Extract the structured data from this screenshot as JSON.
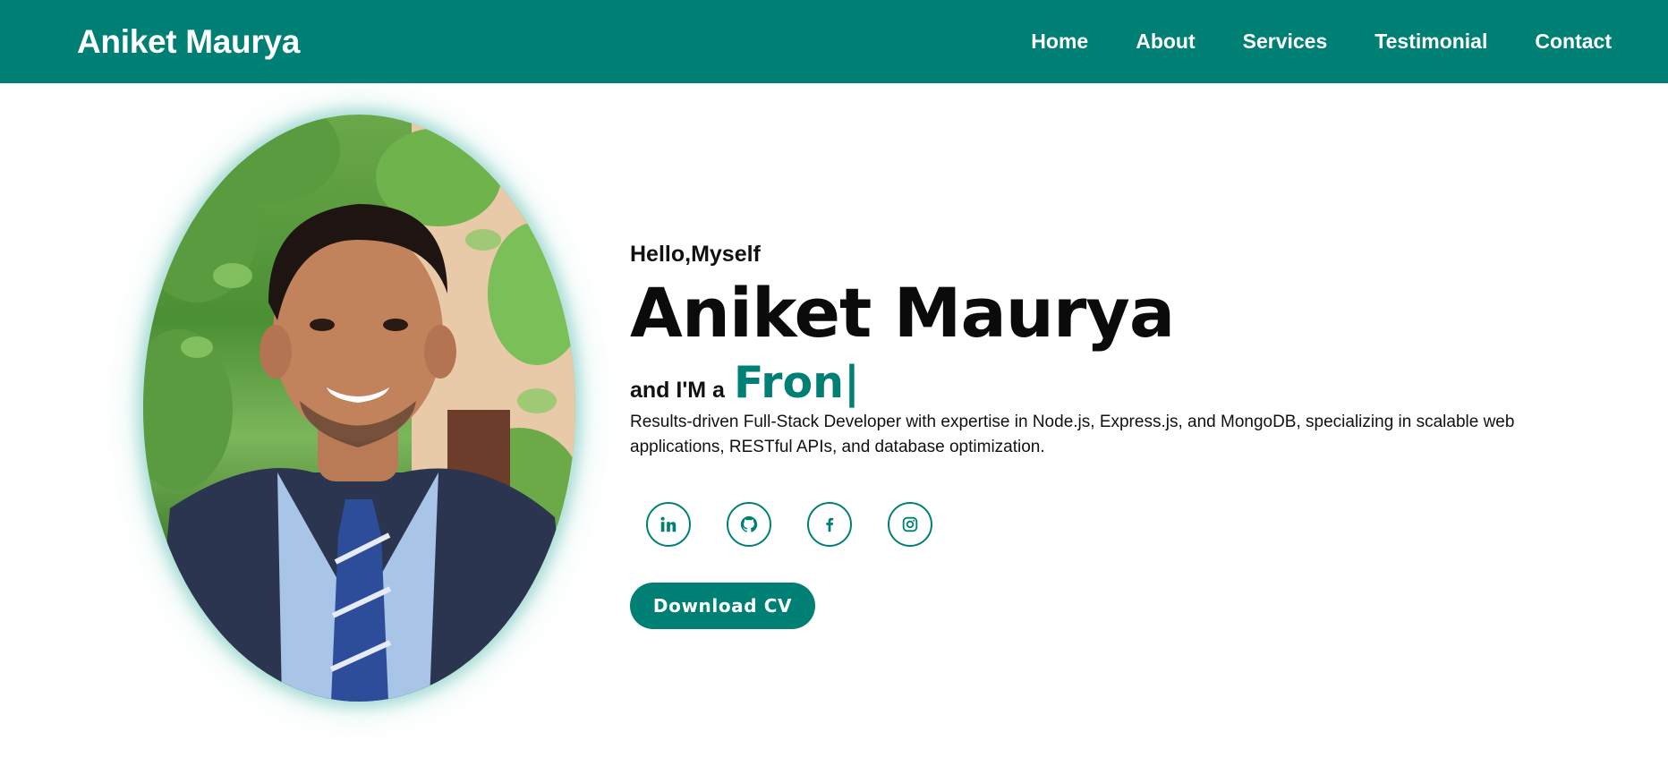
{
  "header": {
    "brand": "Aniket Maurya",
    "nav": [
      "Home",
      "About",
      "Services",
      "Testimonial",
      "Contact"
    ]
  },
  "hero": {
    "greeting": "Hello,Myself",
    "name": "Aniket Maurya",
    "role_prefix": "and I'M a",
    "role_typed": "Fron|",
    "description": "Results-driven Full-Stack Developer with expertise in Node.js, Express.js, and MongoDB, specializing in scalable web applications, RESTful APIs, and database optimization.",
    "cv_button": "Download CV"
  },
  "socials": [
    {
      "name": "linkedin-icon"
    },
    {
      "name": "github-icon"
    },
    {
      "name": "facebook-icon"
    },
    {
      "name": "instagram-icon"
    }
  ],
  "colors": {
    "accent": "#008075",
    "text": "#111111",
    "background": "#ffffff"
  }
}
